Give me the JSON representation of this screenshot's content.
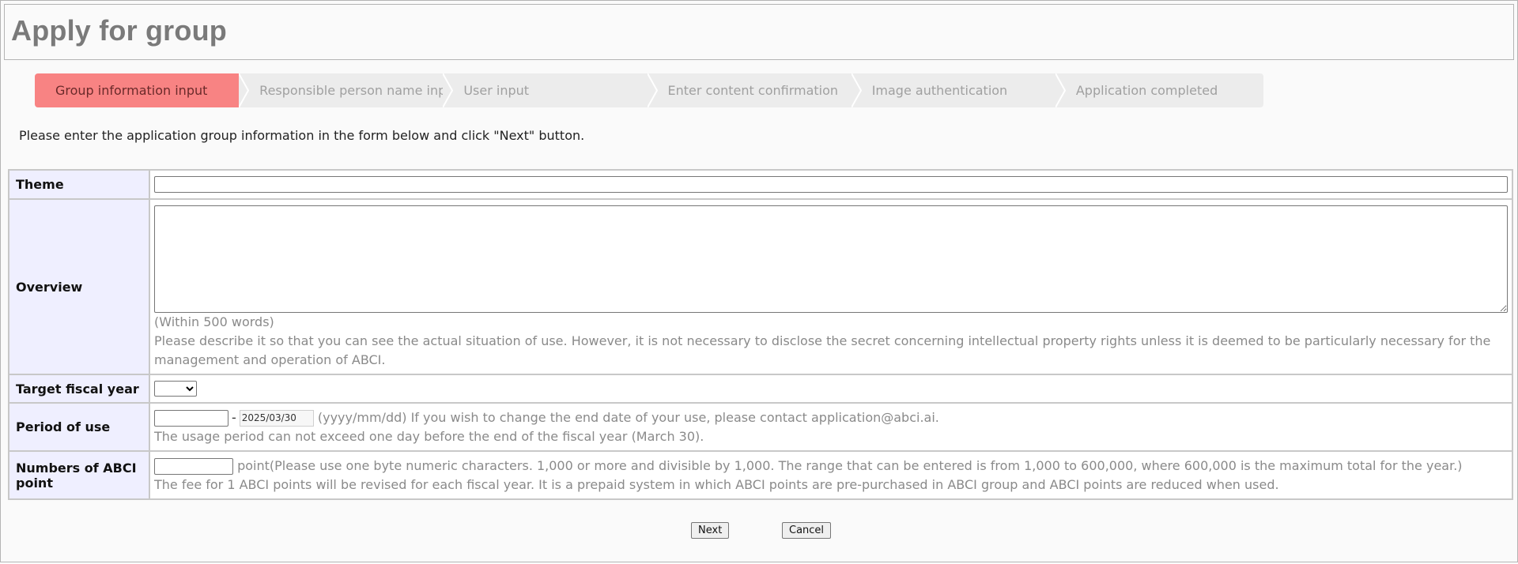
{
  "page": {
    "title": "Apply for group"
  },
  "steps": [
    {
      "label": "Group information input",
      "active": true
    },
    {
      "label": "Responsible person name input",
      "active": false
    },
    {
      "label": "User input",
      "active": false
    },
    {
      "label": "Enter content confirmation",
      "active": false
    },
    {
      "label": "Image authentication",
      "active": false
    },
    {
      "label": "Application completed",
      "active": false
    }
  ],
  "instructions": "Please enter the application group information in the form below and click \"Next\" button.",
  "form": {
    "theme": {
      "label": "Theme",
      "value": ""
    },
    "overview": {
      "label": "Overview",
      "value": "",
      "note1": "(Within 500 words)",
      "note2": "Please describe it so that you can see the actual situation of use. However, it is not necessary to disclose the secret concerning intellectual property rights unless it is deemed to be particularly necessary for the management and operation of ABCI."
    },
    "fiscal_year": {
      "label": "Target fiscal year",
      "selected": ""
    },
    "period": {
      "label": "Period of use",
      "start": "",
      "separator": "-",
      "end": "2025/03/30",
      "note1": "(yyyy/mm/dd) If you wish to change the end date of your use, please contact application@abci.ai.",
      "note2": "The usage period can not exceed one day before the end of the fiscal year (March 30)."
    },
    "points": {
      "label": "Numbers of ABCI point",
      "value": "",
      "note1": "point(Please use one byte numeric characters. 1,000 or more and divisible by 1,000. The range that can be entered is from 1,000 to 600,000, where 600,000 is the maximum total for the year.)",
      "note2": "The fee for 1 ABCI points will be revised for each fiscal year. It is a prepaid system in which ABCI points are pre-purchased in ABCI group and ABCI points are reduced when used."
    }
  },
  "buttons": {
    "next": "Next",
    "cancel": "Cancel"
  },
  "colors": {
    "active_step": "#f88383",
    "label_bg": "#efefff",
    "step_bg": "#ececec"
  }
}
